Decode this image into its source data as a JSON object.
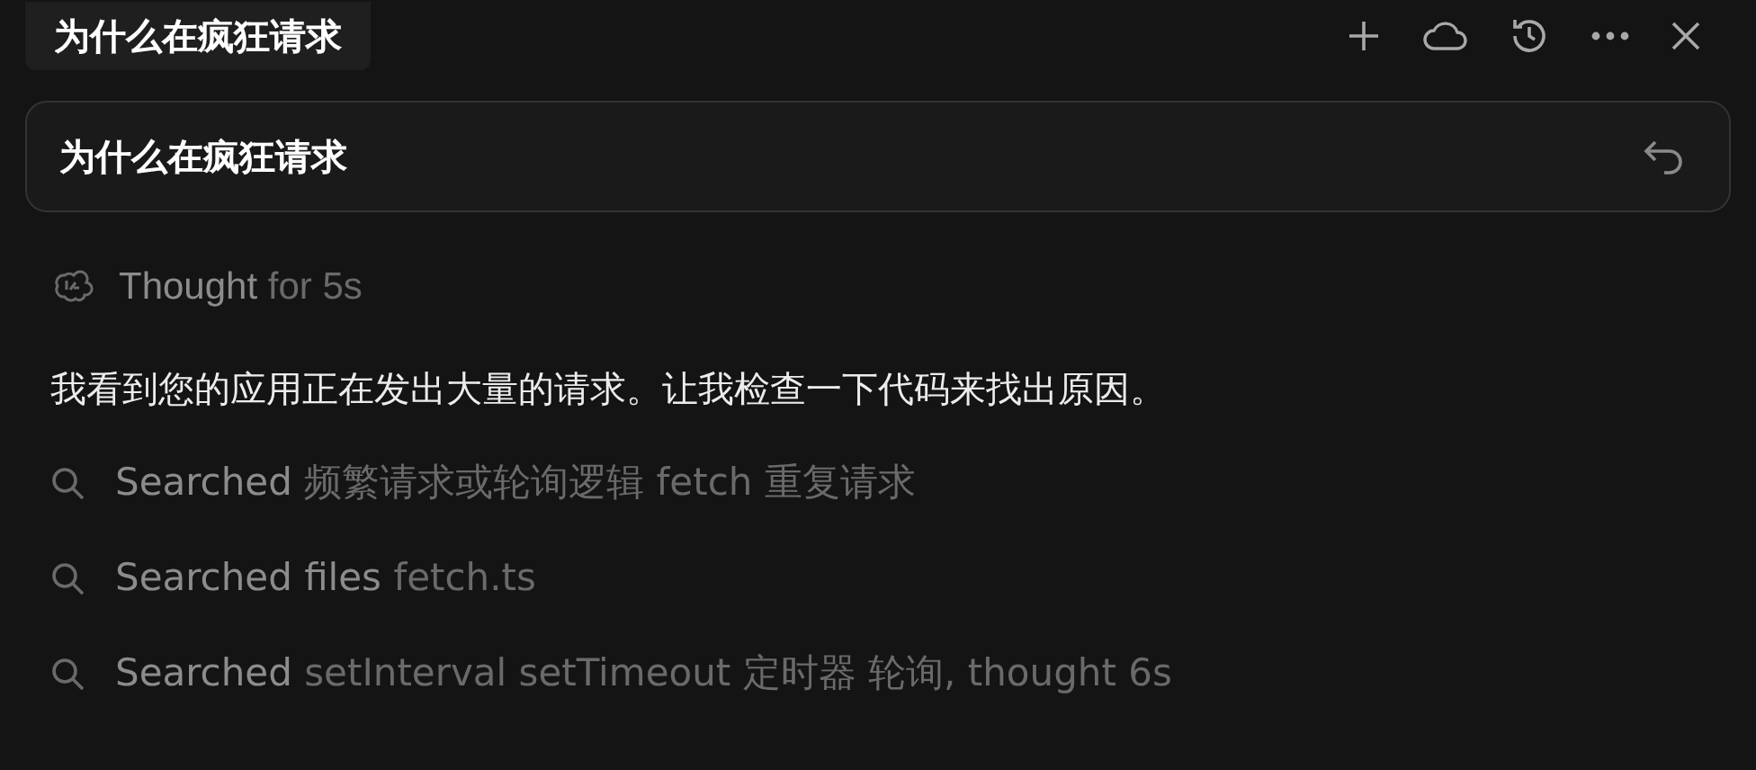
{
  "tab": {
    "title": "为什么在疯狂请求"
  },
  "query": {
    "value": "为什么在疯狂请求"
  },
  "thought": {
    "label": "Thought",
    "detail": "for 5s"
  },
  "message": "我看到您的应用正在发出大量的请求。让我检查一下代码来找出原因。",
  "steps": [
    {
      "label": "Searched",
      "detail": "频繁请求或轮询逻辑 fetch 重复请求"
    },
    {
      "label": "Searched files",
      "detail": "fetch.ts"
    },
    {
      "label": "Searched",
      "detail": "setInterval setTimeout 定时器 轮询, thought 6s"
    }
  ]
}
